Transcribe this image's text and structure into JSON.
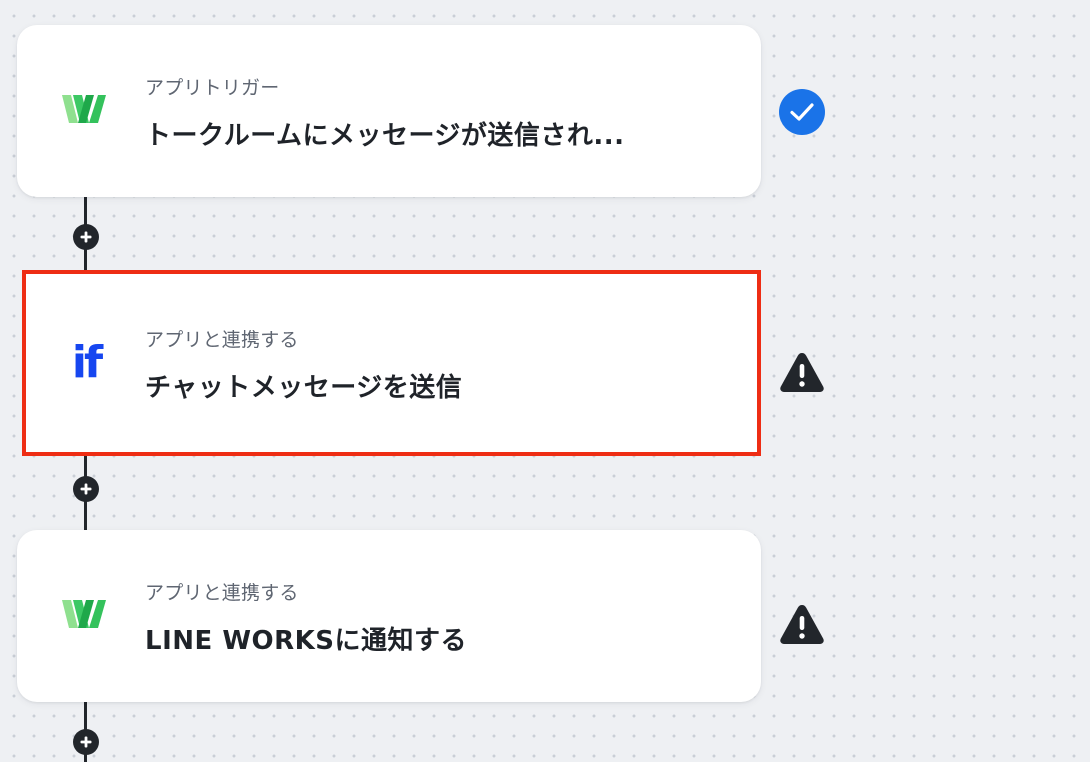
{
  "flow": {
    "steps": [
      {
        "type_label": "アプリトリガー",
        "title": "トークルームにメッセージが送信され...",
        "app_icon": "line-works-logo",
        "status_icon": "check-circle-icon",
        "selected": false
      },
      {
        "type_label": "アプリと連携する",
        "title": "チャットメッセージを送信",
        "app_icon": "if-logo",
        "app_icon_text": "if",
        "status_icon": "warning-icon",
        "selected": true
      },
      {
        "type_label": "アプリと連携する",
        "title": "LINE WORKSに通知する",
        "app_icon": "line-works-logo",
        "status_icon": "warning-icon",
        "selected": false
      }
    ],
    "add_step_icon": "plus-icon"
  },
  "colors": {
    "selection_border": "#ee2d14",
    "success": "#1a73e8",
    "warning": "#22262b",
    "if_logo": "#1646f0",
    "line_works_green": "#3cc864"
  }
}
